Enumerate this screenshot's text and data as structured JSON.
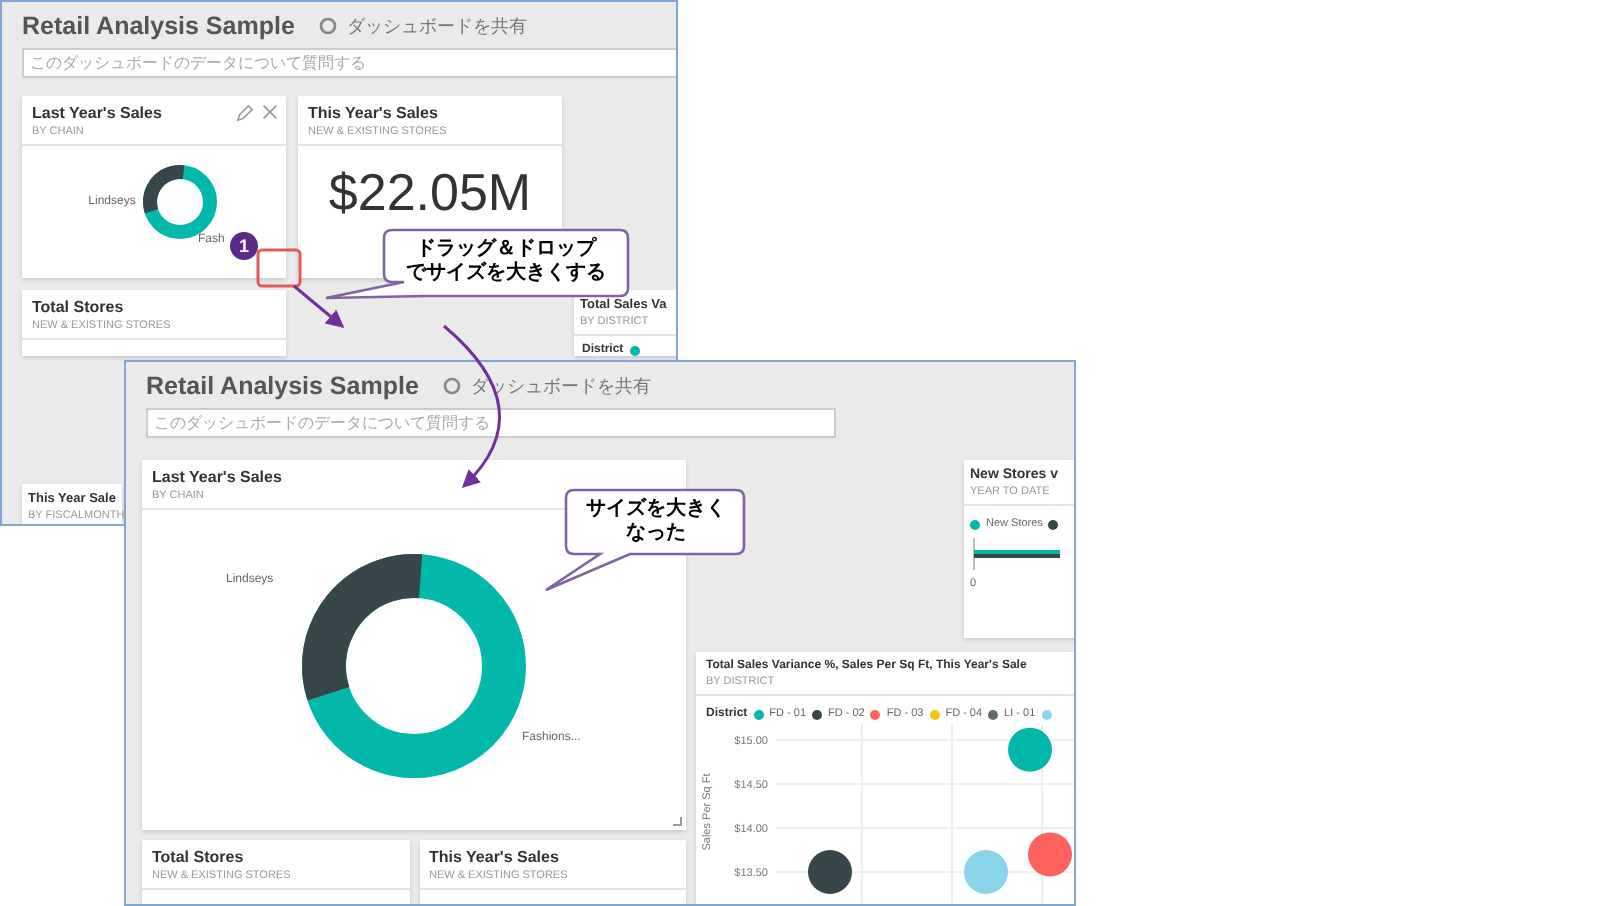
{
  "back_screen": {
    "title": "Retail Analysis Sample",
    "share": "ダッシュボードを共有",
    "search": {
      "placeholder": "このダッシュボードのデータについて質問する"
    },
    "tiles": [
      {
        "kind": "donut",
        "title": "Last Year's Sales",
        "subtitle": "BY CHAIN",
        "tools": true,
        "labels": [
          "Lindseys",
          "Fash"
        ]
      },
      {
        "kind": "number",
        "title": "This Year's Sales",
        "subtitle": "NEW & EXISTING STORES",
        "value": "$22.05M"
      },
      {
        "kind": "blank"
      },
      {
        "kind": "line",
        "title": "Total Stores",
        "subtitle": "NEW & EXISTING STORES"
      },
      {
        "kind": "blank"
      },
      {
        "kind": "legend",
        "title": "Total Sales Va",
        "subtitle": "BY DISTRICT",
        "legend": "District"
      },
      {
        "kind": "line",
        "title": "This Year Sale",
        "subtitle": "BY FISCALMONTH"
      }
    ]
  },
  "front_screen": {
    "title": "Retail Analysis Sample",
    "share": "ダッシュボードを共有",
    "search": {
      "placeholder": "このダッシュボードのデータについて質問する"
    },
    "main_tile": {
      "title": "Last Year's Sales",
      "subtitle": "BY CHAIN",
      "labels": [
        "Lindseys",
        "Fashions..."
      ]
    },
    "new_stores_tile": {
      "title": "New Stores v",
      "subtitle": "YEAR TO DATE",
      "legend": "New Stores",
      "axis": "0"
    },
    "scatter_tile": {
      "title": "Total Sales Variance %, Sales Per Sq Ft, This Year's Sale",
      "subtitle": "BY DISTRICT",
      "legend_title": "District",
      "chart_data": {
        "type": "scatter",
        "ylabel": "Sales Per Sq Ft",
        "grid": true,
        "ylim": [
          13.5,
          15
        ],
        "yticks": [
          {
            "value": 15,
            "label": "$15.00"
          },
          {
            "value": 14.5,
            "label": "$14.50"
          },
          {
            "value": 14,
            "label": "$14.00"
          },
          {
            "value": 13.5,
            "label": "$13.50"
          }
        ],
        "series": [
          {
            "name": "FD - 01",
            "color": "#01b8aa",
            "values": [
              14.89
            ]
          },
          {
            "name": "FD - 02",
            "color": "#374649",
            "values": [
              13.5
            ]
          },
          {
            "name": "FD - 03",
            "color": "#fd625e",
            "values": [
              13.7
            ]
          },
          {
            "name": "FD - 04",
            "color": "#f2c80f"
          },
          {
            "name": "LI - 01",
            "color": "#5f6b6d"
          },
          {
            "color": "#8ad4eb",
            "values": [
              13.5
            ]
          }
        ]
      }
    },
    "bottom_tiles": [
      {
        "title": "Total Stores",
        "subtitle": "NEW & EXISTING STORES"
      },
      {
        "title": "This Year's Sales",
        "subtitle": "NEW & EXISTING STORES"
      }
    ]
  },
  "annotations": {
    "step_badge": "1",
    "callouts": [
      {
        "lines": [
          "ドラッグ＆ドロップ",
          "でサイズを大きくする"
        ]
      },
      {
        "lines": [
          "サイズを大きく",
          "なった"
        ]
      }
    ]
  }
}
